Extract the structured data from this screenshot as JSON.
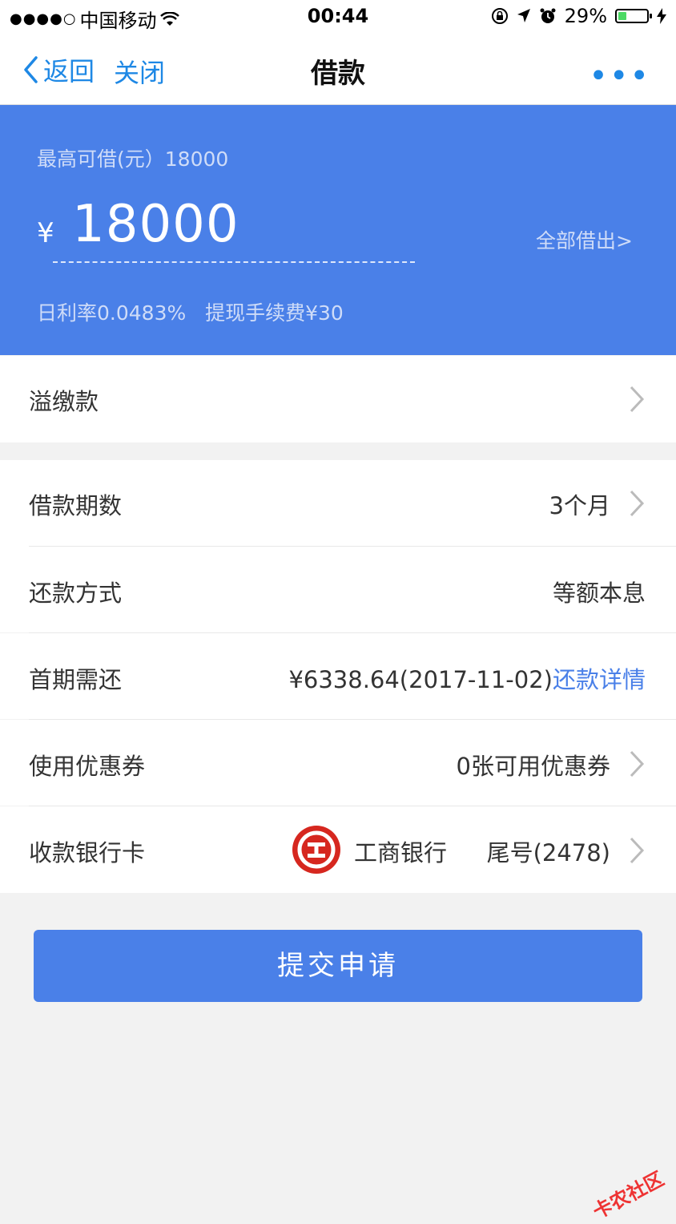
{
  "status_bar": {
    "signal": "●●●●○",
    "carrier": "中国移动",
    "time": "00:44",
    "battery_percent": "29%",
    "battery_level": 0.29
  },
  "nav": {
    "back_label": "返回",
    "close_label": "关闭",
    "title": "借款",
    "more_label": "•••"
  },
  "hero": {
    "max_borrow_label": "最高可借(元）18000",
    "currency": "¥",
    "amount": "18000",
    "borrow_all": "全部借出>",
    "rate_text": "日利率0.0483%   提现手续费¥30"
  },
  "overpaid": {
    "label": "溢缴款"
  },
  "rows": {
    "term": {
      "label": "借款期数",
      "value": "3个月"
    },
    "repay_method": {
      "label": "还款方式",
      "value": "等额本息"
    },
    "first_payment": {
      "label": "首期需还",
      "value": "¥6338.64(2017-11-02)",
      "link": "还款详情"
    },
    "coupon": {
      "label": "使用优惠券",
      "value": "0张可用优惠券"
    },
    "bank_card": {
      "label": "收款银行卡",
      "bank": "工商银行",
      "tail": "尾号(2478)"
    }
  },
  "submit_label": "提交申请",
  "watermark": "卡农社区",
  "colors": {
    "accent": "#4a80e8",
    "link": "#1e88e5",
    "bank_red": "#d6271f"
  }
}
